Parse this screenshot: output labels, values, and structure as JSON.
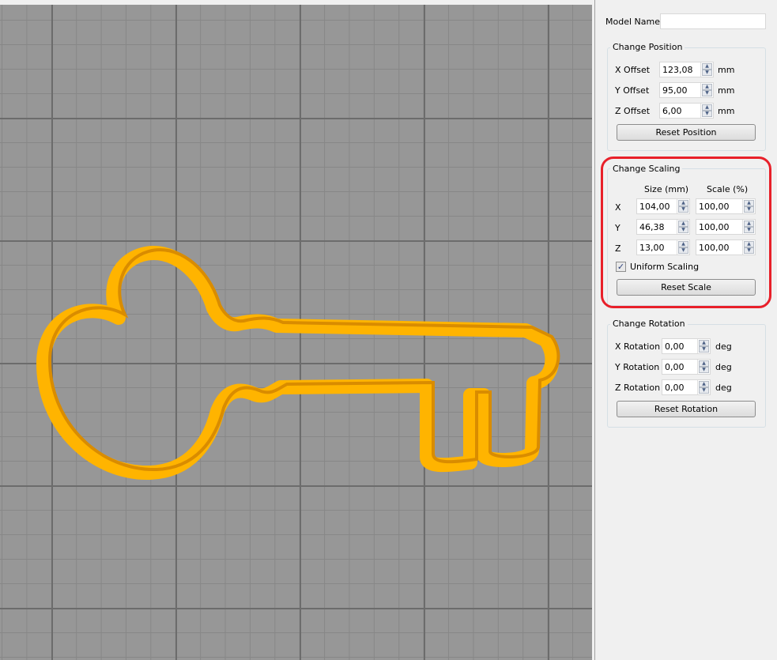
{
  "model_name": {
    "label": "Model Name:",
    "value": ""
  },
  "position": {
    "title": "Change Position",
    "rows": [
      {
        "label": "X Offset",
        "value": "123,08",
        "unit": "mm"
      },
      {
        "label": "Y Offset",
        "value": "95,00",
        "unit": "mm"
      },
      {
        "label": "Z Offset",
        "value": "6,00",
        "unit": "mm"
      }
    ],
    "reset": "Reset Position"
  },
  "scaling": {
    "title": "Change Scaling",
    "size_header": "Size (mm)",
    "scale_header": "Scale (%)",
    "rows": [
      {
        "axis": "X",
        "size": "104,00",
        "scale": "100,00"
      },
      {
        "axis": "Y",
        "size": "46,38",
        "scale": "100,00"
      },
      {
        "axis": "Z",
        "size": "13,00",
        "scale": "100,00"
      }
    ],
    "uniform_label": "Uniform Scaling",
    "uniform_checked": true,
    "reset": "Reset Scale"
  },
  "rotation": {
    "title": "Change Rotation",
    "rows": [
      {
        "label": "X Rotation",
        "value": "0,00",
        "unit": "deg"
      },
      {
        "label": "Y Rotation",
        "value": "0,00",
        "unit": "deg"
      },
      {
        "label": "Z Rotation",
        "value": "0,00",
        "unit": "deg"
      }
    ],
    "reset": "Reset Rotation"
  },
  "colors": {
    "model": "#ffb400",
    "model_shade": "#d98c00",
    "highlight": "#e8202a"
  }
}
